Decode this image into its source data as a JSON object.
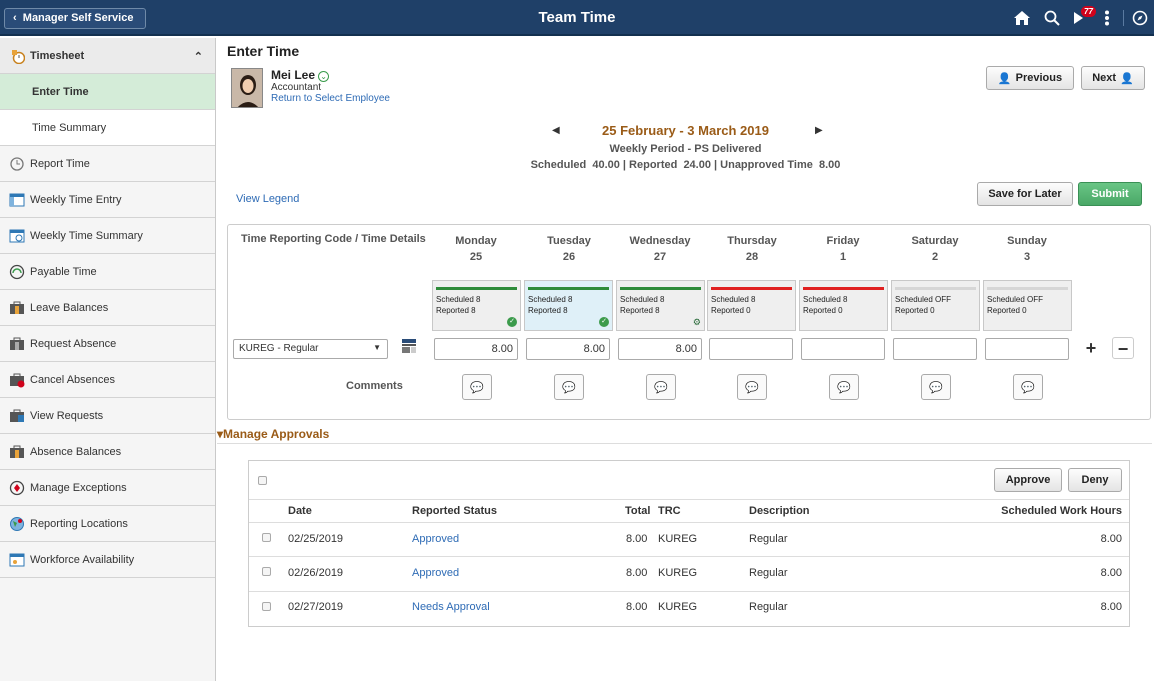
{
  "topbar": {
    "back_label": "Manager Self Service",
    "title": "Team Time",
    "notification_count": "77"
  },
  "sidebar": {
    "group_label": "Timesheet",
    "subitems": [
      "Enter Time",
      "Time Summary"
    ],
    "items": [
      {
        "label": "Report Time",
        "icon": "clock-icon"
      },
      {
        "label": "Weekly Time Entry",
        "icon": "calendar-icon"
      },
      {
        "label": "Weekly Time Summary",
        "icon": "calendar-summary-icon"
      },
      {
        "label": "Payable Time",
        "icon": "gauge-icon"
      },
      {
        "label": "Leave Balances",
        "icon": "suitcase-icon"
      },
      {
        "label": "Request Absence",
        "icon": "suitcase-icon"
      },
      {
        "label": "Cancel Absences",
        "icon": "suitcase-cancel-icon"
      },
      {
        "label": "View Requests",
        "icon": "suitcase-view-icon"
      },
      {
        "label": "Absence Balances",
        "icon": "suitcase-icon"
      },
      {
        "label": "Manage Exceptions",
        "icon": "exception-icon"
      },
      {
        "label": "Reporting Locations",
        "icon": "globe-icon"
      },
      {
        "label": "Workforce Availability",
        "icon": "availability-icon"
      }
    ]
  },
  "page": {
    "title": "Enter Time",
    "employee": {
      "name": "Mei Lee",
      "role": "Accountant",
      "return_link": "Return to Select Employee"
    },
    "prev_label": "Previous",
    "next_label": "Next",
    "period_title": "25 February - 3 March 2019",
    "period_sub": "Weekly Period - PS Delivered",
    "stats": "Scheduled  40.00 | Reported  24.00 | Unapproved Time  8.00",
    "view_legend": "View Legend",
    "save_label": "Save for Later",
    "submit_label": "Submit"
  },
  "timesheet": {
    "trc_header": "Time Reporting Code / Time Details",
    "days": [
      {
        "name": "Monday",
        "date": "25",
        "scheduled": "Scheduled 8",
        "reported": "Reported  8",
        "hours": "8.00",
        "status_color": "#2e8b3a",
        "check": true
      },
      {
        "name": "Tuesday",
        "date": "26",
        "scheduled": "Scheduled 8",
        "reported": "Reported  8",
        "hours": "8.00",
        "status_color": "#2e8b3a",
        "check": true
      },
      {
        "name": "Wednesday",
        "date": "27",
        "scheduled": "Scheduled 8",
        "reported": "Reported  8",
        "hours": "8.00",
        "status_color": "#2e8b3a",
        "check": false
      },
      {
        "name": "Thursday",
        "date": "28",
        "scheduled": "Scheduled 8",
        "reported": "Reported  0",
        "hours": "",
        "status_color": "#e02020",
        "check": false
      },
      {
        "name": "Friday",
        "date": "1",
        "scheduled": "Scheduled 8",
        "reported": "Reported  0",
        "hours": "",
        "status_color": "#e02020",
        "check": false
      },
      {
        "name": "Saturday",
        "date": "2",
        "scheduled": "Scheduled OFF",
        "reported": "Reported  0",
        "hours": "",
        "status_color": "#d6d6d6",
        "check": false
      },
      {
        "name": "Sunday",
        "date": "3",
        "scheduled": "Scheduled OFF",
        "reported": "Reported  0",
        "hours": "",
        "status_color": "#d6d6d6",
        "check": false
      }
    ],
    "trc_value": "KUREG - Regular",
    "comments_label": "Comments"
  },
  "approvals": {
    "header": "Manage Approvals",
    "approve_label": "Approve",
    "deny_label": "Deny",
    "columns": [
      "Date",
      "Reported Status",
      "Total",
      "TRC",
      "Description",
      "Scheduled Work Hours"
    ],
    "rows": [
      {
        "date": "02/25/2019",
        "status": "Approved",
        "total": "8.00",
        "trc": "KUREG",
        "description": "Regular",
        "scheduled": "8.00"
      },
      {
        "date": "02/26/2019",
        "status": "Approved",
        "total": "8.00",
        "trc": "KUREG",
        "description": "Regular",
        "scheduled": "8.00"
      },
      {
        "date": "02/27/2019",
        "status": "Needs Approval",
        "total": "8.00",
        "trc": "KUREG",
        "description": "Regular",
        "scheduled": "8.00"
      }
    ]
  }
}
